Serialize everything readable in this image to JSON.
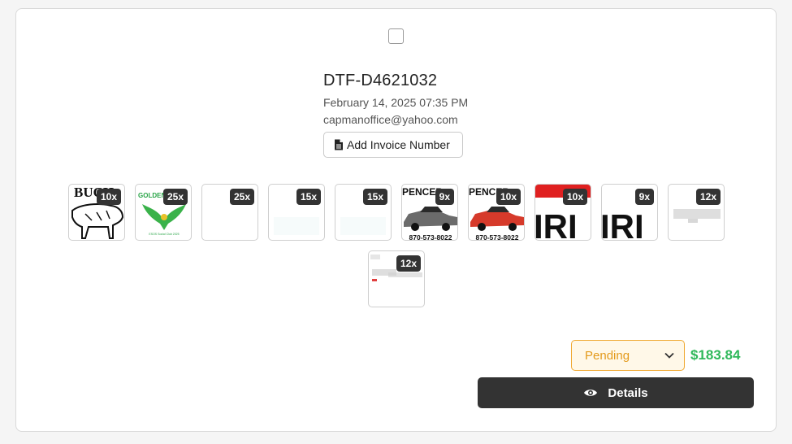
{
  "order": {
    "id": "DTF-D4621032",
    "date": "February 14, 2025 07:35 PM",
    "email": "capmanoffice@yahoo.com",
    "invoice_button_label": "Add Invoice Number"
  },
  "thumbnails": [
    {
      "qty": "10x",
      "overlay_text": "BUCH",
      "icon": "bull-design-thumb"
    },
    {
      "qty": "25x",
      "overlay_text": "GOLDEN",
      "caption": "ESOS Social Club 2025",
      "icon": "eagle-design-thumb"
    },
    {
      "qty": "25x",
      "icon": "blank-design-thumb"
    },
    {
      "qty": "15x",
      "icon": "blank-design-thumb"
    },
    {
      "qty": "15x",
      "icon": "blank-design-thumb"
    },
    {
      "qty": "9x",
      "overlay_text": "PENCER",
      "phone": "870-573-8022",
      "icon": "car-design-thumb"
    },
    {
      "qty": "10x",
      "overlay_text": "PENCER",
      "phone": "870-573-8022",
      "icon": "red-car-design-thumb"
    },
    {
      "qty": "10x",
      "overlay_text": "IRI",
      "icon": "text-design-thumb"
    },
    {
      "qty": "9x",
      "overlay_text": "IRI",
      "icon": "text-design-thumb"
    },
    {
      "qty": "12x",
      "icon": "faint-design-thumb"
    },
    {
      "qty": "12x",
      "icon": "faint-design-thumb"
    }
  ],
  "status": {
    "value": "Pending",
    "color": "#e39a1b"
  },
  "price": "$183.84",
  "details_button_label": "Details",
  "colors": {
    "accent_dark": "#333333",
    "price_green": "#2fb85a",
    "pending_orange": "#f0a830"
  }
}
